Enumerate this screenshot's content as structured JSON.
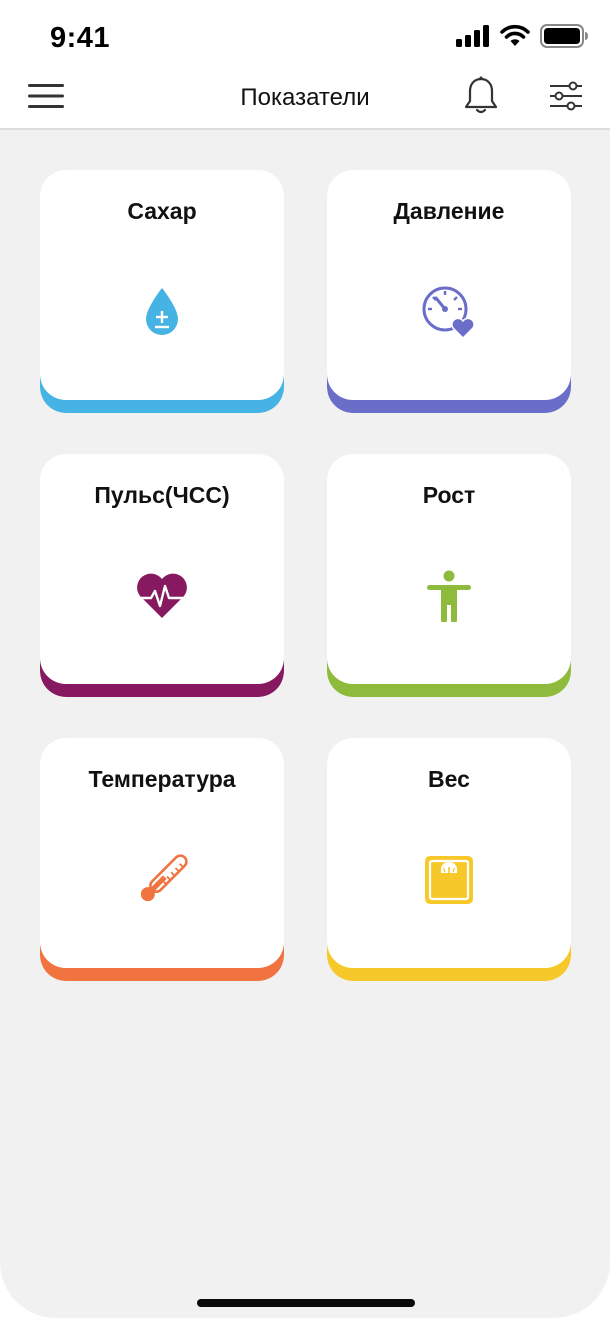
{
  "status_bar": {
    "time": "9:41"
  },
  "nav": {
    "title": "Показатели",
    "menu_icon": "hamburger-menu-icon",
    "notification_icon": "bell-icon",
    "filter_icon": "sliders-icon"
  },
  "cards": [
    {
      "title": "Сахар",
      "icon": "blood-drop-icon",
      "accent": "#45b3e3"
    },
    {
      "title": "Давление",
      "icon": "pressure-gauge-heart-icon",
      "accent": "#6b6ec8"
    },
    {
      "title": "Пульс(ЧСС)",
      "icon": "heart-pulse-icon",
      "accent": "#86195f"
    },
    {
      "title": "Рост",
      "icon": "person-height-icon",
      "accent": "#8ebb3b"
    },
    {
      "title": "Температура",
      "icon": "thermometer-icon",
      "accent": "#f07340"
    },
    {
      "title": "Вес",
      "icon": "scale-icon",
      "accent": "#f7c82a"
    }
  ]
}
